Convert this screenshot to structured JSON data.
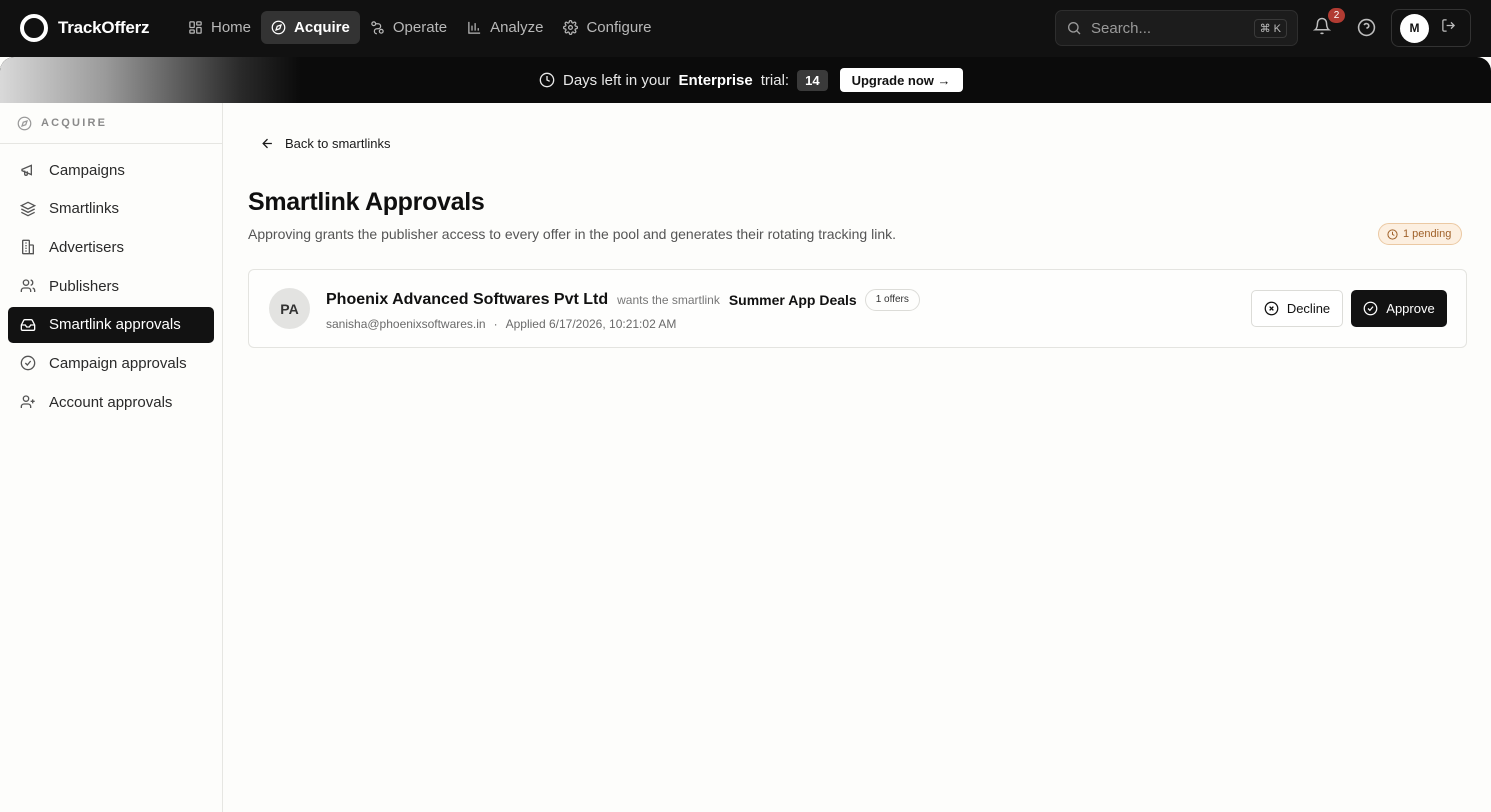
{
  "app": {
    "name": "TrackOfferz"
  },
  "nav": {
    "items": [
      {
        "label": "Home",
        "icon": "grid-icon",
        "active": false
      },
      {
        "label": "Acquire",
        "icon": "compass-icon",
        "active": true
      },
      {
        "label": "Operate",
        "icon": "route-icon",
        "active": false
      },
      {
        "label": "Analyze",
        "icon": "bar-chart-icon",
        "active": false
      },
      {
        "label": "Configure",
        "icon": "gear-icon",
        "active": false
      }
    ]
  },
  "search": {
    "placeholder": "Search...",
    "shortcut": "⌘ K"
  },
  "notifications": {
    "count": "2"
  },
  "user": {
    "initial": "M"
  },
  "banner": {
    "prefix": "Days left in your",
    "plan": "Enterprise",
    "suffix": "trial:",
    "days": "14",
    "cta": "Upgrade now →"
  },
  "sidebar": {
    "section": "ACQUIRE",
    "items": [
      {
        "label": "Campaigns",
        "icon": "megaphone-icon",
        "active": false
      },
      {
        "label": "Smartlinks",
        "icon": "layers-icon",
        "active": false
      },
      {
        "label": "Advertisers",
        "icon": "building-icon",
        "active": false
      },
      {
        "label": "Publishers",
        "icon": "users-icon",
        "active": false
      },
      {
        "label": "Smartlink approvals",
        "icon": "inbox-icon",
        "active": true
      },
      {
        "label": "Campaign approvals",
        "icon": "check-circle-icon",
        "active": false
      },
      {
        "label": "Account approvals",
        "icon": "user-plus-icon",
        "active": false
      }
    ]
  },
  "main": {
    "back_label": "Back to smartlinks",
    "title": "Smartlink Approvals",
    "subtitle": "Approving grants the publisher access to every offer in the pool and generates their rotating tracking link.",
    "pending_badge": "1 pending",
    "requests": [
      {
        "initials": "PA",
        "publisher": "Phoenix Advanced Softwares Pvt Ltd",
        "connector": "wants the smartlink",
        "smartlink": "Summer App Deals",
        "offers": "1 offers",
        "email": "sanisha@phoenixsoftwares.in",
        "separator": "·",
        "applied": "Applied 6/17/2026, 10:21:02 AM",
        "decline_label": "Decline",
        "approve_label": "Approve"
      }
    ]
  },
  "colors": {
    "topbar": "#111111",
    "accent": "#121212",
    "pending_bg": "#fcefe0",
    "pending_text": "#a0622a",
    "notification_badge": "#b13b32"
  }
}
